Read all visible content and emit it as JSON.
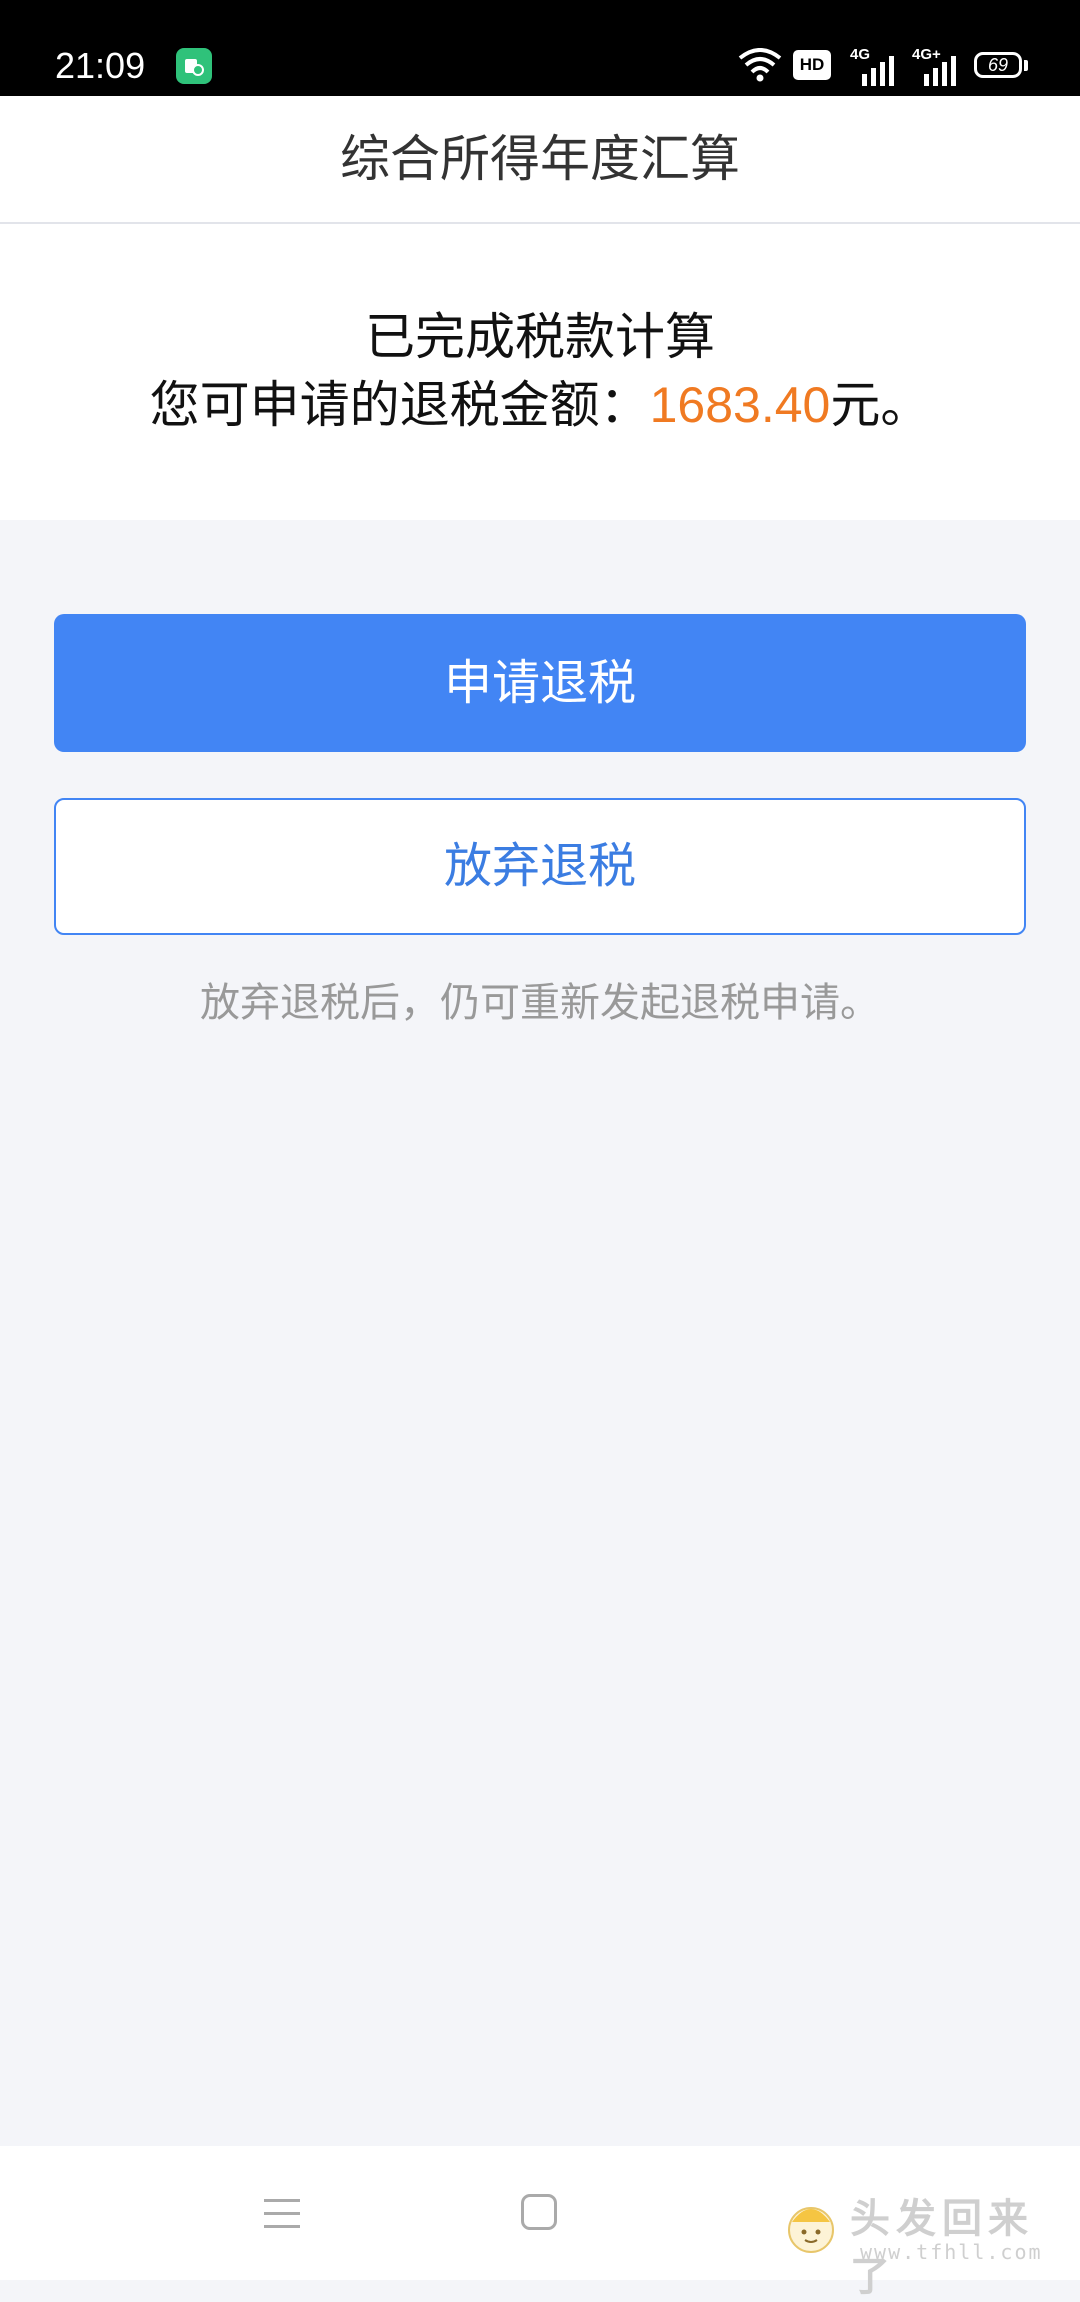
{
  "status_bar": {
    "time": "21:09",
    "hd_label": "HD",
    "signal1_label": "4G",
    "signal2_label": "4G+",
    "battery_level": "69"
  },
  "header": {
    "title": "综合所得年度汇算"
  },
  "result": {
    "line1": "已完成税款计算",
    "line2_prefix": "您可申请的退税金额：",
    "amount": "1683.40",
    "line2_suffix": "元。"
  },
  "actions": {
    "apply_label": "申请退税",
    "abandon_label": "放弃退税",
    "hint": "放弃退税后，仍可重新发起退税申请。"
  },
  "watermark": {
    "text": "头发回来了",
    "url": "www.tfhll.com"
  },
  "colors": {
    "primary": "#4285f4",
    "amount": "#f07a22",
    "hint": "#999999",
    "page_background": "#f4f5f9"
  },
  "icons": [
    "app-notification-icon",
    "wifi-icon",
    "signal-icon",
    "battery-icon",
    "menu-icon",
    "home-icon"
  ]
}
